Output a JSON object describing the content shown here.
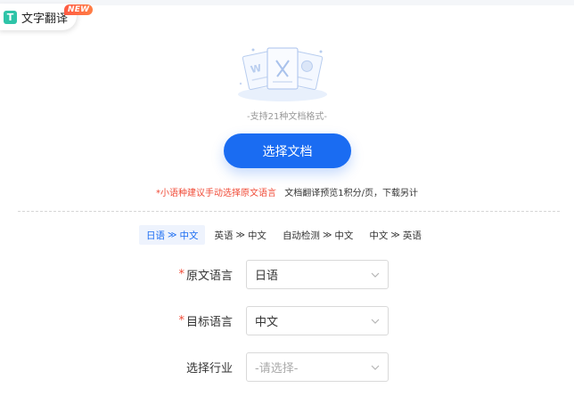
{
  "tab": {
    "icon_letter": "T",
    "label": "文字翻译",
    "badge": "NEW"
  },
  "upload": {
    "support_text": "-支持21种文档格式-",
    "button_label": "选择文档",
    "notice_red": "*小语种建议手动选择原文语言",
    "notice_dark": "文档翻译预览1积分/页，下载另计"
  },
  "quick_pairs": [
    {
      "from": "日语",
      "arrow": "≫",
      "to": "中文",
      "active": true
    },
    {
      "from": "英语",
      "arrow": "≫",
      "to": "中文",
      "active": false
    },
    {
      "from": "自动检测",
      "arrow": "≫",
      "to": "中文",
      "active": false
    },
    {
      "from": "中文",
      "arrow": "≫",
      "to": "英语",
      "active": false
    }
  ],
  "form": {
    "source_lang": {
      "required_mark": "*",
      "label": "原文语言",
      "value": "日语"
    },
    "target_lang": {
      "required_mark": "*",
      "label": "目标语言",
      "value": "中文"
    },
    "industry": {
      "label": "选择行业",
      "placeholder": "-请选择-"
    }
  },
  "colors": {
    "accent": "#1a6cf2",
    "warning": "#f04a36",
    "badge": "#ff5a43",
    "tab_icon": "#2ec4a8"
  }
}
